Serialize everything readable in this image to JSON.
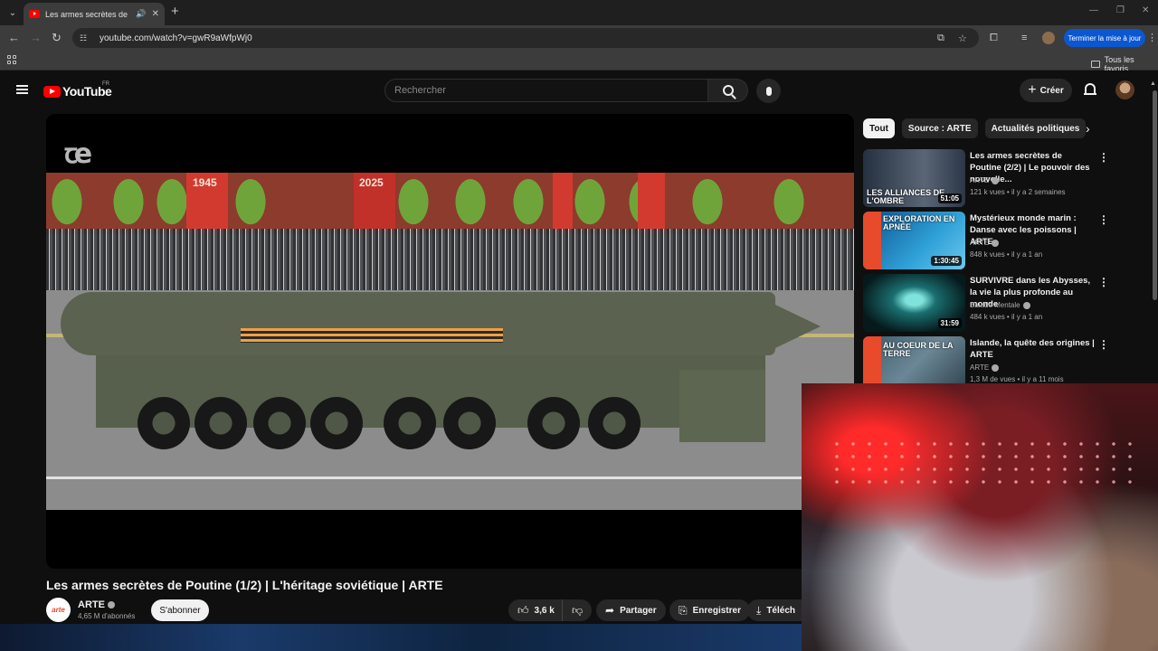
{
  "browser": {
    "tab_title": "Les armes secrètes de Poutine",
    "url": "youtube.com/watch?v=gwR9aWfpWj0",
    "update_label": "Terminer la mise à jour",
    "bookmarks_label": "Tous les favoris"
  },
  "header": {
    "logo_text": "YouTube",
    "country_code": "FR",
    "search_placeholder": "Rechercher",
    "create_label": "Créer"
  },
  "video": {
    "title": "Les armes secrètes de Poutine (1/2) | L'héritage soviétique | ARTE",
    "watermark": "ꞇe",
    "banner_years": [
      "1945",
      "2025"
    ],
    "channel": {
      "name": "ARTE",
      "avatar_text": "arte",
      "subscribers": "4,65 M d'abonnés",
      "subscribe_label": "S'abonner"
    },
    "actions": {
      "likes": "3,6 k",
      "share_label": "Partager",
      "save_label": "Enregistrer",
      "download_label": "Téléch"
    }
  },
  "sidebar": {
    "chips": [
      "Tout",
      "Source : ARTE",
      "Actualités politiques"
    ],
    "recommendations": [
      {
        "title": "Les armes secrètes de Poutine (2/2) | Le pouvoir des nouvelle...",
        "channel": "ARTE",
        "meta": "121 k vues • il y a 2 semaines",
        "duration": "51:05",
        "thumb_caption": "LES ALLIANCES DE L'OMBRE",
        "thumb_color": "#2b3646"
      },
      {
        "title": "Mystérieux monde marin : Danse avec les poissons | ARTE",
        "channel": "ARTE",
        "meta": "848 k vues • il y a 1 an",
        "duration": "1:30:45",
        "thumb_caption": "EXPLORATION EN APNÉE",
        "thumb_color": "#1f86c4"
      },
      {
        "title": "SURVIVRE dans les Abysses, la vie la plus profonde au monde",
        "channel": "Balade Mentale",
        "meta": "484 k vues • il y a 1 an",
        "duration": "31:59",
        "thumb_caption": "",
        "thumb_color": "#0e3a3e"
      },
      {
        "title": "Islande, la quête des origines | ARTE",
        "channel": "ARTE",
        "meta": "1,3 M de vues • il y a 11 mois",
        "duration": "",
        "thumb_caption": "AU COEUR DE LA TERRE",
        "thumb_color": "#4a6a7a"
      }
    ]
  }
}
